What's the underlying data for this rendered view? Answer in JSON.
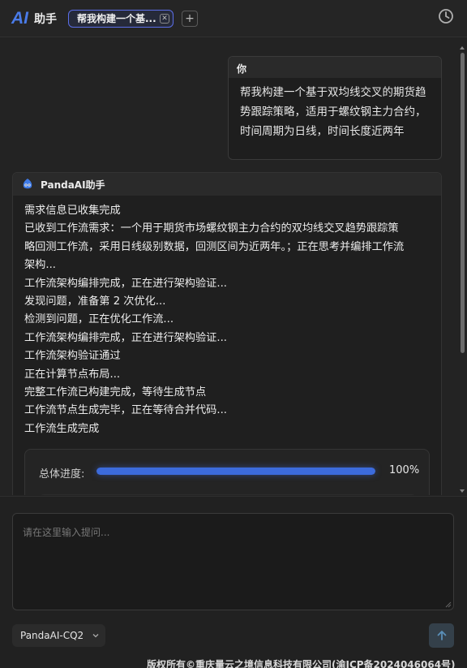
{
  "header": {
    "logo_text": "AI",
    "app_title": "助手",
    "tab_label": "帮我构建一个基...",
    "close_glyph": "✕",
    "add_glyph": "+"
  },
  "chat": {
    "user_message": {
      "sender": "你",
      "text": "帮我构建一个基于双均线交叉的期货趋势跟踪策略，适用于螺纹钢主力合约，时间周期为日线，时间长度近两年"
    },
    "ai_message": {
      "sender": "PandaAI助手",
      "lines": [
        "需求信息已收集完成",
        "已收到工作流需求：一个用于期货市场螺纹钢主力合约的双均线交叉趋势跟踪策",
        "略回测工作流，采用日线级别数据，回测区间为近两年。；正在思考并编排工作流",
        "架构...",
        "工作流架构编排完成，正在进行架构验证...",
        "发现问题，准备第 2 次优化...",
        "检测到问题，正在优化工作流...",
        "工作流架构编排完成，正在进行架构验证...",
        "工作流架构验证通过",
        "正在计算节点布局...",
        "完整工作流已构建完成，等待生成节点",
        "工作流节点生成完毕，正在等待合并代码...",
        "工作流生成完成"
      ],
      "progress": {
        "label": "总体进度:",
        "percent_text": "100%",
        "value": 1.0
      }
    }
  },
  "input": {
    "placeholder": "请在这里输入提问...",
    "value": ""
  },
  "model_selector": {
    "selected": "PandaAI-CQ2"
  },
  "footer": {
    "copyright": "版权所有©重庆量云之境信息科技有限公司(渝ICP备2024046064号)"
  },
  "colors": {
    "accent": "#3c6bdc",
    "logo": "#4a7be8",
    "tab_border": "#5b6ee8",
    "background": "#232323"
  },
  "icons": {
    "history": "history-clock-icon",
    "send": "arrow-up-icon",
    "avatar": "panda-avatar-icon",
    "chevron": "chevron-down-icon"
  }
}
